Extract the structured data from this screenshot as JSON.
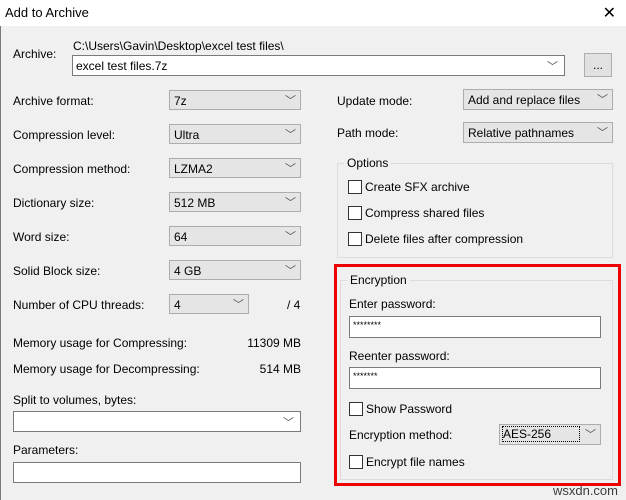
{
  "window": {
    "title": "Add to Archive",
    "close_icon": "close-icon"
  },
  "archive": {
    "label": "Archive:",
    "path": "C:\\Users\\Gavin\\Desktop\\excel test files\\",
    "filename": "excel test files.7z",
    "browse_label": "..."
  },
  "left": {
    "archive_format": {
      "label": "Archive format:",
      "value": "7z"
    },
    "compression_level": {
      "label": "Compression level:",
      "value": "Ultra"
    },
    "compression_method": {
      "label": "Compression method:",
      "value": "LZMA2"
    },
    "dictionary_size": {
      "label": "Dictionary size:",
      "value": "512 MB"
    },
    "word_size": {
      "label": "Word size:",
      "value": "64"
    },
    "solid_block_size": {
      "label": "Solid Block size:",
      "value": "4 GB"
    },
    "cpu_threads": {
      "label": "Number of CPU threads:",
      "value": "4",
      "max": "/ 4"
    },
    "memory_compress": {
      "label": "Memory usage for Compressing:",
      "value": "11309 MB"
    },
    "memory_decompress": {
      "label": "Memory usage for Decompressing:",
      "value": "514 MB"
    },
    "split_volumes": {
      "label": "Split to volumes, bytes:",
      "value": ""
    },
    "parameters": {
      "label": "Parameters:",
      "value": ""
    }
  },
  "right": {
    "update_mode": {
      "label": "Update mode:",
      "value": "Add and replace files"
    },
    "path_mode": {
      "label": "Path mode:",
      "value": "Relative pathnames"
    },
    "options": {
      "title": "Options",
      "items": [
        {
          "label": "Create SFX archive",
          "checked": false
        },
        {
          "label": "Compress shared files",
          "checked": false
        },
        {
          "label": "Delete files after compression",
          "checked": false
        }
      ]
    },
    "encryption": {
      "title": "Encryption",
      "enter_password_label": "Enter password:",
      "enter_password_value": "********",
      "reenter_password_label": "Reenter password:",
      "reenter_password_value": "*******",
      "show_password_label": "Show Password",
      "method_label": "Encryption method:",
      "method_value": "AES-256",
      "encrypt_names_label": "Encrypt file names"
    }
  },
  "watermark": "wsxdn.com",
  "colors": {
    "highlight": "#e00000"
  }
}
